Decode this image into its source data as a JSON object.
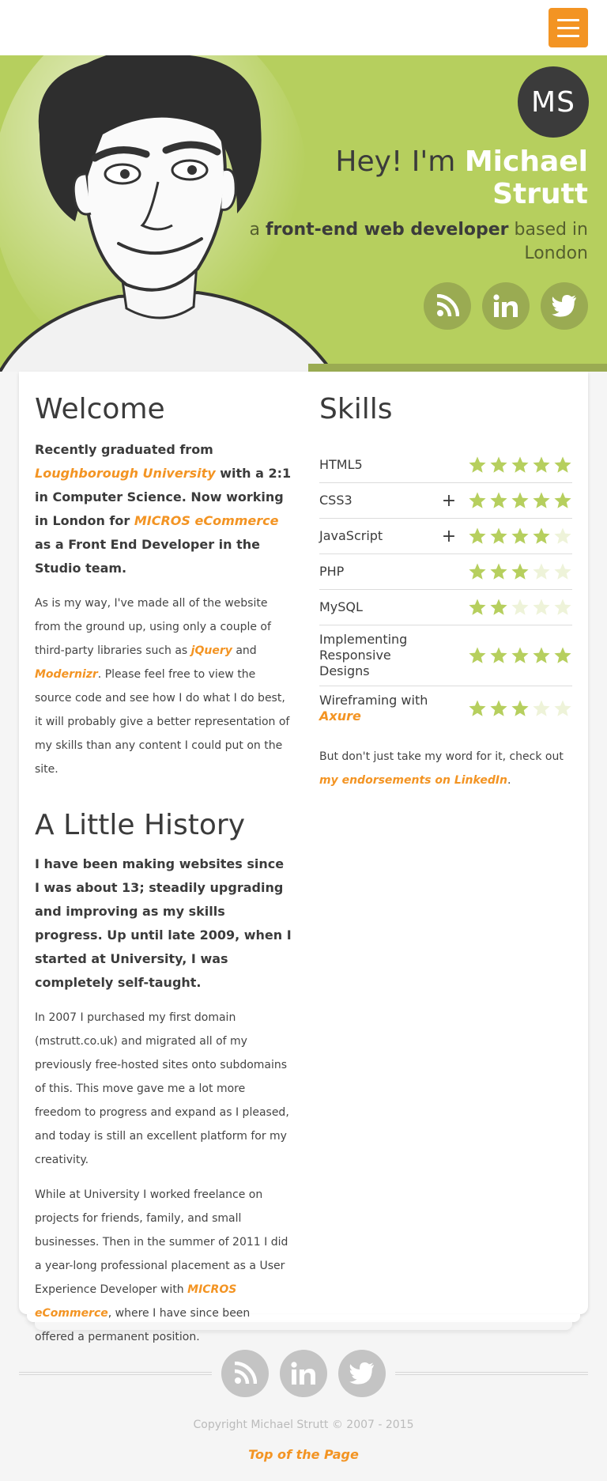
{
  "header": {
    "menu_label": "menu"
  },
  "hero": {
    "initials": "MS",
    "greeting": "Hey! I'm",
    "name": "Michael Strutt",
    "sub_a": "a",
    "sub_role": "front-end web developer",
    "sub_b": "based in London",
    "social": [
      "rss-icon",
      "linkedin-icon",
      "twitter-icon"
    ]
  },
  "welcome": {
    "title": "Welcome",
    "lead_1": "Recently graduated from",
    "lead_link_1": "Loughborough University",
    "lead_2": "with a 2:1 in Computer Science. Now working in London for",
    "lead_link_2": "MICROS eCommerce",
    "lead_3": "as a Front End Developer in the Studio team.",
    "para_1": "As is my way, I've made all of the website from the ground up, using only a couple of third-party libraries such as",
    "para_link_1": "jQuery",
    "para_2": "and",
    "para_link_2": "Modernizr",
    "para_3": ". Please feel free to view the source code and see how I do what I do best, it will probably give a better representation of my skills than any content I could put on the site."
  },
  "history": {
    "title": "A Little History",
    "lead": "I have been making websites since I was about 13; steadily upgrading and improving as my skills progress. Up until late 2009, when I started at University, I was completely self-taught.",
    "para_1": "In 2007 I purchased my first domain (mstrutt.co.uk) and migrated all of my previously free-hosted sites onto subdomains of this. This move gave me a lot more freedom to progress and expand as I pleased, and today is still an excellent platform for my creativity.",
    "para_2": "While at University I worked freelance on projects for friends, family, and small businesses. Then in the summer of 2011 I did a year-long professional placement as a User Experience Developer with",
    "para_2_link": "MICROS eCommerce",
    "para_2_end": ", where I have since been offered a permanent position."
  },
  "skills": {
    "title": "Skills",
    "items": [
      {
        "name": "HTML5",
        "link": "",
        "expand": "",
        "rating": 5
      },
      {
        "name": "CSS3",
        "link": "",
        "expand": "+",
        "rating": 5
      },
      {
        "name": "JavaScript",
        "link": "",
        "expand": "+",
        "rating": 4
      },
      {
        "name": "PHP",
        "link": "",
        "expand": "",
        "rating": 3
      },
      {
        "name": "MySQL",
        "link": "",
        "expand": "",
        "rating": 2
      },
      {
        "name": "Implementing Responsive Designs",
        "link": "",
        "expand": "",
        "rating": 5
      },
      {
        "name": "Wireframing with",
        "link": "Axure",
        "expand": "",
        "rating": 3
      }
    ],
    "endorse_text": "But don't just take my word for it, check out",
    "endorse_link": "my endorsements on LinkedIn",
    "endorse_end": "."
  },
  "footer": {
    "copyright": "Copyright Michael Strutt © 2007 - 2015",
    "top_link": "Top of the Page"
  },
  "colors": {
    "accent": "#f39423",
    "hero_green": "#b6cf5e",
    "star_on": "#b6cf5e",
    "star_off": "#eef3d9"
  }
}
